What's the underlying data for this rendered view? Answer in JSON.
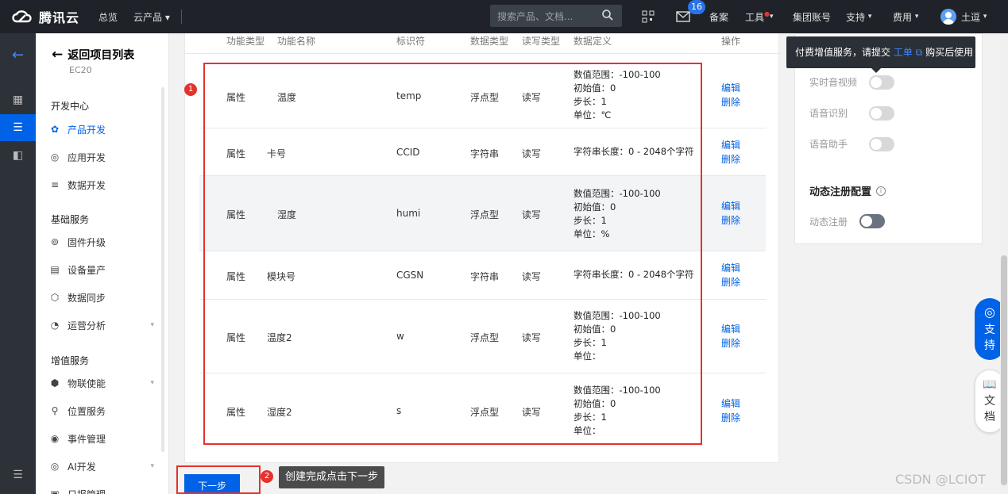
{
  "topbar": {
    "logo_text": "腾讯云",
    "nav": [
      "总览",
      "云产品"
    ],
    "search_placeholder": "搜索产品、文档...",
    "message_count": "16",
    "right_items": [
      "备案",
      "工具",
      "集团账号",
      "支持",
      "费用"
    ],
    "user_name": "土逗"
  },
  "sidebar": {
    "back_label": "返回项目列表",
    "project_name": "EC20",
    "sections": [
      {
        "title": "开发中心",
        "items": [
          "产品开发",
          "应用开发",
          "数据开发"
        ]
      },
      {
        "title": "基础服务",
        "items": [
          "固件升级",
          "设备量产",
          "数据同步",
          "运营分析"
        ]
      },
      {
        "title": "增值服务",
        "items": [
          "物联使能",
          "位置服务",
          "事件管理",
          "AI开发",
          "日报管理"
        ]
      }
    ],
    "active_item": "产品开发"
  },
  "table": {
    "headers": [
      "功能类型",
      "功能名称",
      "标识符",
      "数据类型",
      "读写类型",
      "数据定义",
      "操作"
    ],
    "rows": [
      {
        "type": "属性",
        "name": "温度",
        "id": "temp",
        "dtype": "浮点型",
        "rw": "读写",
        "def": [
          "数值范围：-100-100",
          "初始值：0",
          "步长：1",
          "单位：℃"
        ]
      },
      {
        "type": "属性",
        "name": "卡号",
        "id": "CCID",
        "dtype": "字符串",
        "rw": "读写",
        "def": [
          "字符串长度：0 - 2048个字符"
        ]
      },
      {
        "type": "属性",
        "name": "湿度",
        "id": "humi",
        "dtype": "浮点型",
        "rw": "读写",
        "def": [
          "数值范围：-100-100",
          "初始值：0",
          "步长：1",
          "单位：%"
        ]
      },
      {
        "type": "属性",
        "name": "模块号",
        "id": "CGSN",
        "dtype": "字符串",
        "rw": "读写",
        "def": [
          "字符串长度：0 - 2048个字符"
        ]
      },
      {
        "type": "属性",
        "name": "温度2",
        "id": "w",
        "dtype": "浮点型",
        "rw": "读写",
        "def": [
          "数值范围：-100-100",
          "初始值：0",
          "步长：1",
          "单位："
        ]
      },
      {
        "type": "属性",
        "name": "湿度2",
        "id": "s",
        "dtype": "浮点型",
        "rw": "读写",
        "def": [
          "数值范围：-100-100",
          "初始值：0",
          "步长：1",
          "单位："
        ]
      }
    ],
    "edit_label": "编辑",
    "delete_label": "删除"
  },
  "annotations": {
    "badge1": "1",
    "badge2": "2",
    "callout": "创建完成点击下一步"
  },
  "next_button": "下一步",
  "right_panel": {
    "tooltip_text": "付费增值服务，请提交",
    "tooltip_link": "工单",
    "tooltip_tail": "购买后使用",
    "toggles": [
      "实时音视频",
      "语音识别",
      "语音助手"
    ],
    "heading": "动态注册配置",
    "dynamic_label": "动态注册"
  },
  "float_buttons": {
    "support": [
      "支",
      "持"
    ],
    "docs": [
      "文",
      "档"
    ]
  },
  "watermark": "CSDN @LCIOT"
}
